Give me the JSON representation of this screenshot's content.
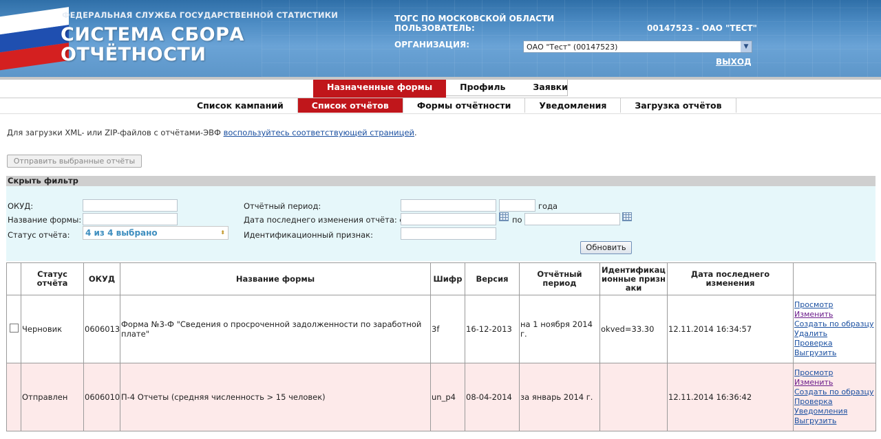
{
  "header": {
    "federal_service": "ФЕДЕРАЛЬНАЯ СЛУЖБА ГОСУДАРСТВЕННОЙ СТАТИСТИКИ",
    "system_title_1": "СИСТЕМА СБОРА",
    "system_title_2": "ОТЧЁТНОСТИ",
    "togs": "ТОГС ПО МОСКОВСКОЙ ОБЛАСТИ",
    "user_label": "ПОЛЬЗОВАТЕЛЬ:",
    "user_value": "00147523 - ОАО \"ТЕСТ\"",
    "org_label": "ОРГАНИЗАЦИЯ:",
    "org_value": "ОАО \"Тест\" (00147523)",
    "logout": "ВЫХОД"
  },
  "nav_main": [
    "Назначенные формы",
    "Профиль",
    "Заявки"
  ],
  "nav_sub": [
    "Список кампаний",
    "Список отчётов",
    "Формы отчётности",
    "Уведомления",
    "Загрузка отчётов"
  ],
  "info": {
    "text": "Для загрузки XML- или ZIP-файлов с отчётами-ЭВФ",
    "link": "воспользуйтесь соответствующей страницей",
    "dot": "."
  },
  "send_button": "Отправить выбранные отчёты",
  "filter": {
    "header": "Скрыть фильтр",
    "okud_label": "ОКУД:",
    "form_name_label": "Название формы:",
    "status_label": "Статус отчёта:",
    "status_value": "4 из 4 выбрано",
    "period_label": "Отчётный период:",
    "year_suffix": "года",
    "last_change_label": "Дата последнего изменения отчёта: с",
    "to_label": "по",
    "id_label": "Идентификационный признак:",
    "update_button": "Обновить"
  },
  "table": {
    "columns": [
      "",
      "Статус отчёта",
      "ОКУД",
      "Название формы",
      "Шифр",
      "Версия",
      "Отчётный период",
      "Идентификационные признаки",
      "Дата последнего изменения",
      ""
    ],
    "rows": [
      {
        "status": "Черновик",
        "okud": "0606013",
        "form_name": "Форма №3-Ф \"Сведения о просроченной задолженности по заработной плате\"",
        "code": "3f",
        "version": "16-12-2013",
        "period": "на 1 ноября 2014 г.",
        "id": "okved=33.30",
        "changed": "12.11.2014 16:34:57",
        "actions": [
          "Просмотр",
          "Изменить",
          "Создать по образцу",
          "Удалить",
          "Проверка",
          "Выгрузить"
        ]
      },
      {
        "status": "Отправлен",
        "okud": "0606010",
        "form_name": "П-4 Отчеты (средняя численность > 15 человек)",
        "code": "un_p4",
        "version": "08-04-2014",
        "period": "за январь 2014 г.",
        "id": "",
        "changed": "12.11.2014 16:36:42",
        "actions": [
          "Просмотр",
          "Изменить",
          "Создать по образцу",
          "Проверка",
          "Уведомления",
          "Выгрузить"
        ]
      }
    ]
  }
}
